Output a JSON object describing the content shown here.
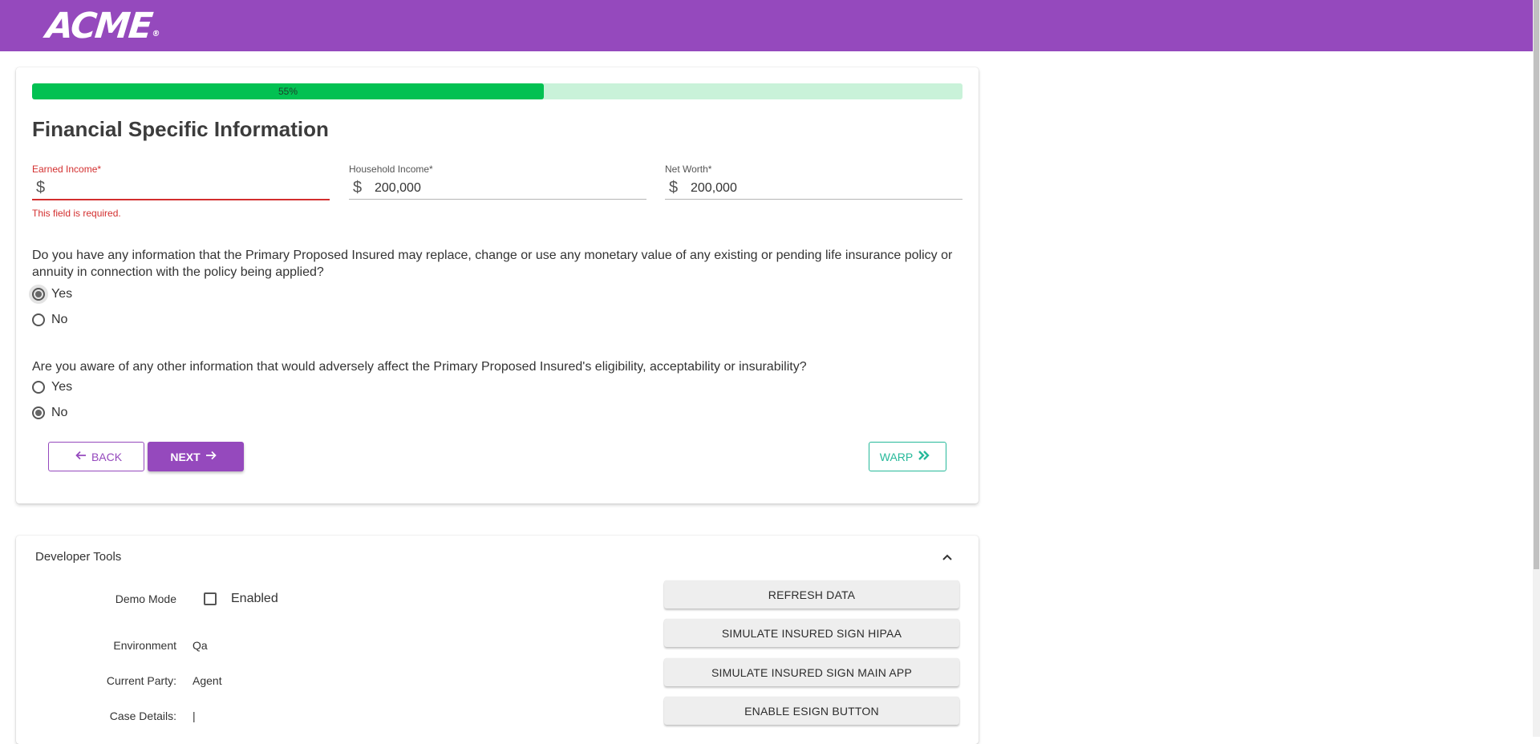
{
  "header": {
    "logo_text": "ACME",
    "logo_mark": "®",
    "background_color": "#9549bd"
  },
  "progress": {
    "percent": 55,
    "label": "55%",
    "fill_color": "#02c152",
    "track_color": "#c9f2d9"
  },
  "form": {
    "title": "Financial Specific Information",
    "fields": [
      {
        "label": "Earned Income*",
        "currency": "$",
        "value": "",
        "error": "This field is required."
      },
      {
        "label": "Household Income*",
        "currency": "$",
        "value": "200,000"
      },
      {
        "label": "Net Worth*",
        "currency": "$",
        "value": "200,000"
      }
    ],
    "questions": [
      {
        "text": "Do you have any information that the Primary Proposed Insured may replace, change or use any monetary value of any existing or pending life insurance policy or annuity in connection with the policy being applied?",
        "options": [
          "Yes",
          "No"
        ],
        "selected": "Yes"
      },
      {
        "text": "Are you aware of any other information that would adversely affect the Primary Proposed Insured's eligibility, acceptability or insurability?",
        "options": [
          "Yes",
          "No"
        ],
        "selected": "No"
      }
    ],
    "buttons": {
      "back": "Back",
      "next": "Next",
      "warp": "Warp"
    }
  },
  "dev_tools": {
    "title": "Developer Tools",
    "demo_mode": {
      "label": "Demo Mode",
      "checkbox_label": "Enabled",
      "checked": false
    },
    "environment": {
      "label": "Environment",
      "value": "Qa"
    },
    "current_party": {
      "label": "Current Party:",
      "value": "Agent"
    },
    "case_details": {
      "label": "Case Details:",
      "value": "|"
    },
    "actions": [
      "Refresh Data",
      "Simulate Insured Sign HIPAA",
      "Simulate Insured Sign Main App",
      "Enable ESign Button"
    ]
  },
  "icons": {
    "back": "arrow-left-icon",
    "next": "arrow-right-icon",
    "warp": "double-chevron-right-icon",
    "collapse": "chevron-up-icon"
  },
  "colors": {
    "primary": "#9549bd",
    "warp": "#26b99a",
    "error": "#d32f2f"
  }
}
